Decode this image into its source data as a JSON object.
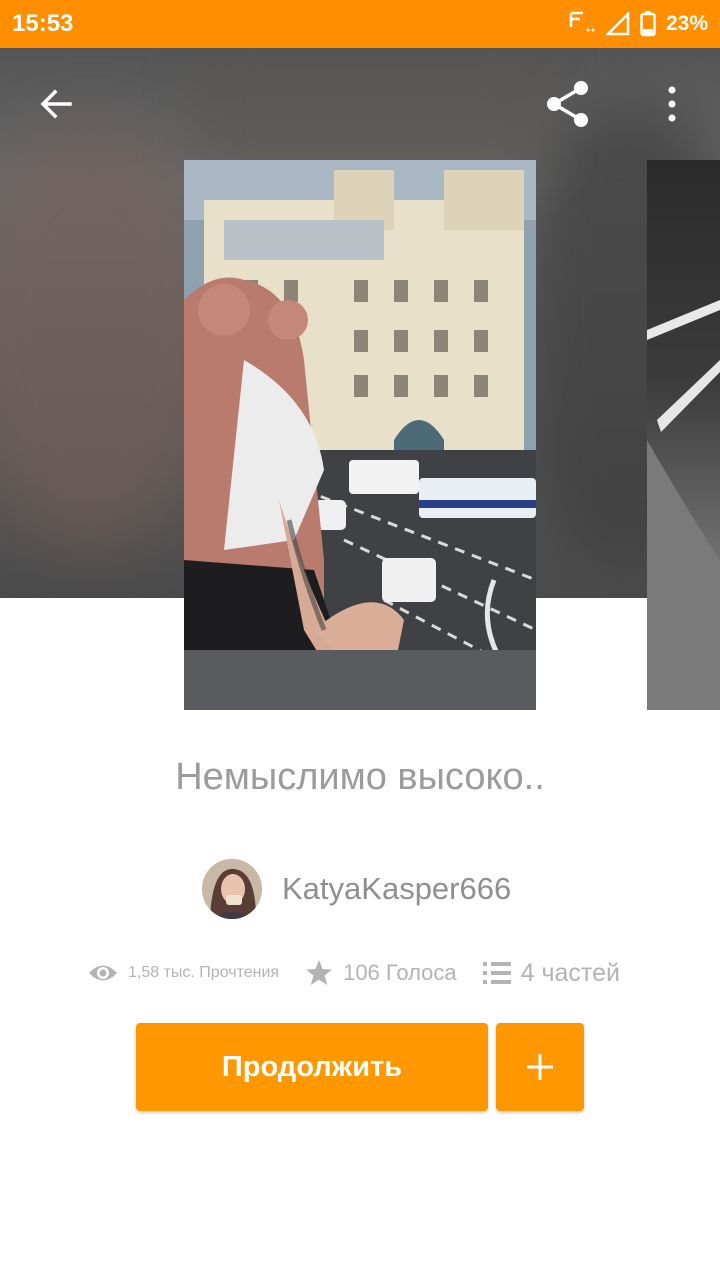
{
  "status_bar": {
    "time": "15:53",
    "battery": "23%",
    "background": "#ff8f00"
  },
  "toolbar": {
    "back_icon": "arrow-left-icon",
    "share_icon": "share-icon",
    "more_icon": "more-vertical-icon"
  },
  "story": {
    "title": "Немыслимо высоко..",
    "author": "KatyaKasper666",
    "stats": {
      "reads": "1,58 тыс. Прочтения",
      "votes": "106 Голоса",
      "parts": "4 частей"
    }
  },
  "actions": {
    "continue_label": "Продолжить",
    "add_icon": "plus-icon",
    "accent": "#ff9800"
  }
}
